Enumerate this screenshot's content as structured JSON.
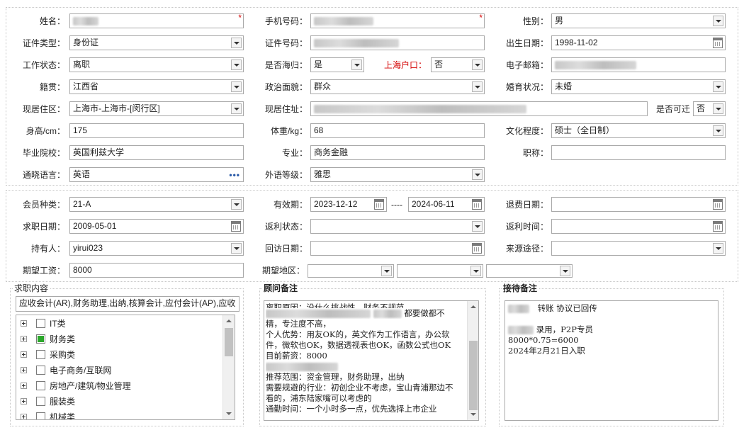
{
  "personal": {
    "name": {
      "label": "姓名：",
      "required": "*"
    },
    "phone": {
      "label": "手机号码：",
      "required": "*"
    },
    "gender": {
      "label": "性别：",
      "value": "男"
    },
    "id_type": {
      "label": "证件类型：",
      "value": "身份证"
    },
    "id_number": {
      "label": "证件号码："
    },
    "birth_date": {
      "label": "出生日期：",
      "value": "1998-11-02"
    },
    "work_status": {
      "label": "工作状态：",
      "value": "离职"
    },
    "returnee": {
      "label": "是否海归：",
      "value": "是"
    },
    "shanghai_hukou": {
      "label": "上海户口：",
      "value": "否"
    },
    "email": {
      "label": "电子邮箱："
    },
    "native_place": {
      "label": "籍贯：",
      "value": "江西省"
    },
    "political": {
      "label": "政治面貌：",
      "value": "群众"
    },
    "marital": {
      "label": "婚育状况：",
      "value": "未婚"
    },
    "residence_area": {
      "label": "现居住区：",
      "value": "上海市-上海市-[闵行区]"
    },
    "address": {
      "label": "现居住址："
    },
    "transfer": {
      "label": "是否可迁",
      "value": "否"
    },
    "height": {
      "label": "身高/cm：",
      "value": "175"
    },
    "weight": {
      "label": "体重/kg：",
      "value": "68"
    },
    "education": {
      "label": "文化程度：",
      "value": "硕士（全日制）"
    },
    "school": {
      "label": "毕业院校：",
      "value": "英国利兹大学"
    },
    "major": {
      "label": "专业：",
      "value": "商务金融"
    },
    "title": {
      "label": "职称：",
      "value": ""
    },
    "language": {
      "label": "通晓语言：",
      "value": "英语",
      "more": "•••"
    },
    "language_level": {
      "label": "外语等级：",
      "value": "雅思"
    }
  },
  "member": {
    "member_type": {
      "label": "会员种类：",
      "value": "21-A"
    },
    "valid": {
      "label": "有效期：",
      "from": "2023-12-12",
      "sep": "----",
      "to": "2024-06-11"
    },
    "refund_date": {
      "label": "退费日期：",
      "value": ""
    },
    "job_date": {
      "label": "求职日期：",
      "value": "2009-05-01"
    },
    "rebate_status": {
      "label": "返利状态：",
      "value": ""
    },
    "rebate_time": {
      "label": "返利时间：",
      "value": ""
    },
    "holder": {
      "label": "持有人：",
      "value": "yirui023"
    },
    "visit_date": {
      "label": "回访日期：",
      "value": ""
    },
    "source": {
      "label": "来源途径：",
      "value": ""
    },
    "salary": {
      "label": "期望工资：",
      "value": "8000"
    },
    "area": {
      "label": "期望地区：",
      "values": [
        "",
        "",
        ""
      ]
    }
  },
  "job": {
    "title": "求职内容",
    "summary": "应收会计(AR),财务助理,出纳,核算会计,应付会计(AP),应收",
    "categories": [
      {
        "label": "IT类",
        "checked": false
      },
      {
        "label": "财务类",
        "checked": true
      },
      {
        "label": "采购类",
        "checked": false
      },
      {
        "label": "电子商务/互联网",
        "checked": false
      },
      {
        "label": "房地产/建筑/物业管理",
        "checked": false
      },
      {
        "label": "服装类",
        "checked": false
      },
      {
        "label": "机械类",
        "checked": false
      }
    ]
  },
  "advisor": {
    "title": "顾问备注",
    "lines": [
      "离职原因：没什么挑战性，财务不规范，",
      "都要做都不",
      "精，专注度不高，",
      "个人优势：用友OK的，英文作为工作语言，办公软",
      "件，微软也OK，数据透视表也OK，函数公式也OK",
      "目前薪资：8000",
      "推荐范围：资金管理，财务助理，出纳",
      "需要规避的行业：初创企业不考虑，宝山青浦那边不",
      "看的，浦东陆家嘴可以考虑的",
      "通勤时间：一个小时多一点，优先选择上市企业"
    ]
  },
  "reception": {
    "title": "接待备注",
    "line1": "转账  协议已回传",
    "line2": "录用，P2P专员",
    "line3": "8000*0.75=6000",
    "line4": "2024年2月21日入职"
  }
}
